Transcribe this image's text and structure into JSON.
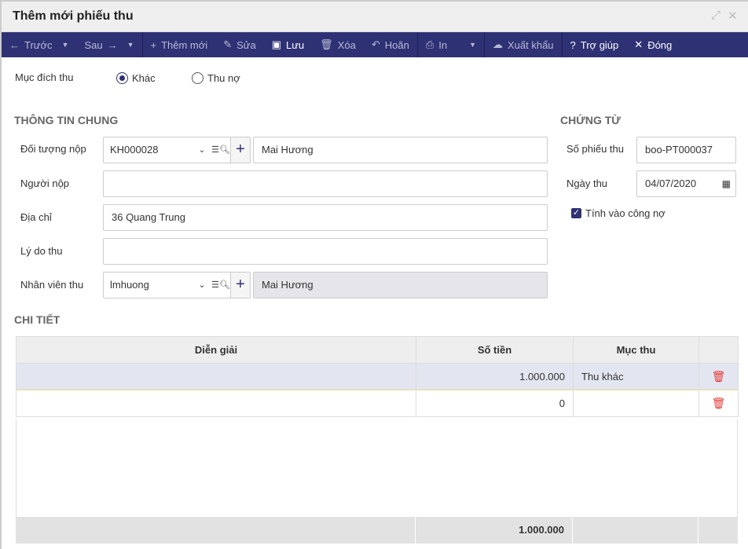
{
  "window": {
    "title": "Thêm mới phiếu thu"
  },
  "toolbar": {
    "prev": "Trước",
    "next": "Sau",
    "add": "Thêm mới",
    "edit": "Sửa",
    "save": "Lưu",
    "delete": "Xóa",
    "undo": "Hoãn",
    "print": "In",
    "export": "Xuất khẩu",
    "help": "Trợ giúp",
    "close": "Đóng"
  },
  "purpose": {
    "label": "Mục đích thu",
    "options": [
      "Khác",
      "Thu nợ"
    ],
    "selected": "Khác"
  },
  "general": {
    "title": "THÔNG TIN CHUNG",
    "payer_label": "Đối tượng nộp",
    "payer_code": "KH000028",
    "payer_name": "Mai Hương",
    "person_label": "Người nộp",
    "person_value": "",
    "address_label": "Địa chỉ",
    "address_value": "36 Quang Trung",
    "reason_label": "Lý do thu",
    "reason_value": "",
    "staff_label": "Nhân viên thu",
    "staff_code": "lmhuong",
    "staff_name": "Mai Hương"
  },
  "voucher": {
    "title": "CHỨNG TỪ",
    "number_label": "Số phiếu thu",
    "number_value": "boo-PT000037",
    "date_label": "Ngày thu",
    "date_value": "04/07/2020",
    "debt_label": "Tính vào công nợ",
    "debt_checked": true
  },
  "detail": {
    "title": "CHI TIẾT",
    "columns": [
      "Diễn giải",
      "Số tiền",
      "Mục thu",
      ""
    ],
    "rows": [
      {
        "desc": "",
        "amount": "1.000.000",
        "category": "Thu khác"
      },
      {
        "desc": "",
        "amount": "0",
        "category": ""
      }
    ],
    "total": "1.000.000"
  }
}
